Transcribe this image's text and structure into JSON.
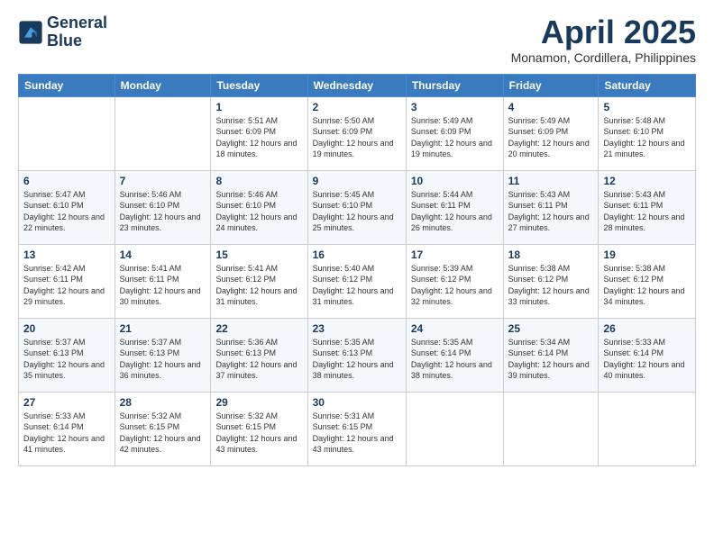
{
  "header": {
    "logo_line1": "General",
    "logo_line2": "Blue",
    "month": "April 2025",
    "location": "Monamon, Cordillera, Philippines"
  },
  "weekdays": [
    "Sunday",
    "Monday",
    "Tuesday",
    "Wednesday",
    "Thursday",
    "Friday",
    "Saturday"
  ],
  "weeks": [
    [
      {
        "day": "",
        "info": ""
      },
      {
        "day": "",
        "info": ""
      },
      {
        "day": "1",
        "sunrise": "Sunrise: 5:51 AM",
        "sunset": "Sunset: 6:09 PM",
        "daylight": "Daylight: 12 hours and 18 minutes."
      },
      {
        "day": "2",
        "sunrise": "Sunrise: 5:50 AM",
        "sunset": "Sunset: 6:09 PM",
        "daylight": "Daylight: 12 hours and 19 minutes."
      },
      {
        "day": "3",
        "sunrise": "Sunrise: 5:49 AM",
        "sunset": "Sunset: 6:09 PM",
        "daylight": "Daylight: 12 hours and 19 minutes."
      },
      {
        "day": "4",
        "sunrise": "Sunrise: 5:49 AM",
        "sunset": "Sunset: 6:09 PM",
        "daylight": "Daylight: 12 hours and 20 minutes."
      },
      {
        "day": "5",
        "sunrise": "Sunrise: 5:48 AM",
        "sunset": "Sunset: 6:10 PM",
        "daylight": "Daylight: 12 hours and 21 minutes."
      }
    ],
    [
      {
        "day": "6",
        "sunrise": "Sunrise: 5:47 AM",
        "sunset": "Sunset: 6:10 PM",
        "daylight": "Daylight: 12 hours and 22 minutes."
      },
      {
        "day": "7",
        "sunrise": "Sunrise: 5:46 AM",
        "sunset": "Sunset: 6:10 PM",
        "daylight": "Daylight: 12 hours and 23 minutes."
      },
      {
        "day": "8",
        "sunrise": "Sunrise: 5:46 AM",
        "sunset": "Sunset: 6:10 PM",
        "daylight": "Daylight: 12 hours and 24 minutes."
      },
      {
        "day": "9",
        "sunrise": "Sunrise: 5:45 AM",
        "sunset": "Sunset: 6:10 PM",
        "daylight": "Daylight: 12 hours and 25 minutes."
      },
      {
        "day": "10",
        "sunrise": "Sunrise: 5:44 AM",
        "sunset": "Sunset: 6:11 PM",
        "daylight": "Daylight: 12 hours and 26 minutes."
      },
      {
        "day": "11",
        "sunrise": "Sunrise: 5:43 AM",
        "sunset": "Sunset: 6:11 PM",
        "daylight": "Daylight: 12 hours and 27 minutes."
      },
      {
        "day": "12",
        "sunrise": "Sunrise: 5:43 AM",
        "sunset": "Sunset: 6:11 PM",
        "daylight": "Daylight: 12 hours and 28 minutes."
      }
    ],
    [
      {
        "day": "13",
        "sunrise": "Sunrise: 5:42 AM",
        "sunset": "Sunset: 6:11 PM",
        "daylight": "Daylight: 12 hours and 29 minutes."
      },
      {
        "day": "14",
        "sunrise": "Sunrise: 5:41 AM",
        "sunset": "Sunset: 6:11 PM",
        "daylight": "Daylight: 12 hours and 30 minutes."
      },
      {
        "day": "15",
        "sunrise": "Sunrise: 5:41 AM",
        "sunset": "Sunset: 6:12 PM",
        "daylight": "Daylight: 12 hours and 31 minutes."
      },
      {
        "day": "16",
        "sunrise": "Sunrise: 5:40 AM",
        "sunset": "Sunset: 6:12 PM",
        "daylight": "Daylight: 12 hours and 31 minutes."
      },
      {
        "day": "17",
        "sunrise": "Sunrise: 5:39 AM",
        "sunset": "Sunset: 6:12 PM",
        "daylight": "Daylight: 12 hours and 32 minutes."
      },
      {
        "day": "18",
        "sunrise": "Sunrise: 5:38 AM",
        "sunset": "Sunset: 6:12 PM",
        "daylight": "Daylight: 12 hours and 33 minutes."
      },
      {
        "day": "19",
        "sunrise": "Sunrise: 5:38 AM",
        "sunset": "Sunset: 6:12 PM",
        "daylight": "Daylight: 12 hours and 34 minutes."
      }
    ],
    [
      {
        "day": "20",
        "sunrise": "Sunrise: 5:37 AM",
        "sunset": "Sunset: 6:13 PM",
        "daylight": "Daylight: 12 hours and 35 minutes."
      },
      {
        "day": "21",
        "sunrise": "Sunrise: 5:37 AM",
        "sunset": "Sunset: 6:13 PM",
        "daylight": "Daylight: 12 hours and 36 minutes."
      },
      {
        "day": "22",
        "sunrise": "Sunrise: 5:36 AM",
        "sunset": "Sunset: 6:13 PM",
        "daylight": "Daylight: 12 hours and 37 minutes."
      },
      {
        "day": "23",
        "sunrise": "Sunrise: 5:35 AM",
        "sunset": "Sunset: 6:13 PM",
        "daylight": "Daylight: 12 hours and 38 minutes."
      },
      {
        "day": "24",
        "sunrise": "Sunrise: 5:35 AM",
        "sunset": "Sunset: 6:14 PM",
        "daylight": "Daylight: 12 hours and 38 minutes."
      },
      {
        "day": "25",
        "sunrise": "Sunrise: 5:34 AM",
        "sunset": "Sunset: 6:14 PM",
        "daylight": "Daylight: 12 hours and 39 minutes."
      },
      {
        "day": "26",
        "sunrise": "Sunrise: 5:33 AM",
        "sunset": "Sunset: 6:14 PM",
        "daylight": "Daylight: 12 hours and 40 minutes."
      }
    ],
    [
      {
        "day": "27",
        "sunrise": "Sunrise: 5:33 AM",
        "sunset": "Sunset: 6:14 PM",
        "daylight": "Daylight: 12 hours and 41 minutes."
      },
      {
        "day": "28",
        "sunrise": "Sunrise: 5:32 AM",
        "sunset": "Sunset: 6:15 PM",
        "daylight": "Daylight: 12 hours and 42 minutes."
      },
      {
        "day": "29",
        "sunrise": "Sunrise: 5:32 AM",
        "sunset": "Sunset: 6:15 PM",
        "daylight": "Daylight: 12 hours and 43 minutes."
      },
      {
        "day": "30",
        "sunrise": "Sunrise: 5:31 AM",
        "sunset": "Sunset: 6:15 PM",
        "daylight": "Daylight: 12 hours and 43 minutes."
      },
      {
        "day": "",
        "info": ""
      },
      {
        "day": "",
        "info": ""
      },
      {
        "day": "",
        "info": ""
      }
    ]
  ]
}
